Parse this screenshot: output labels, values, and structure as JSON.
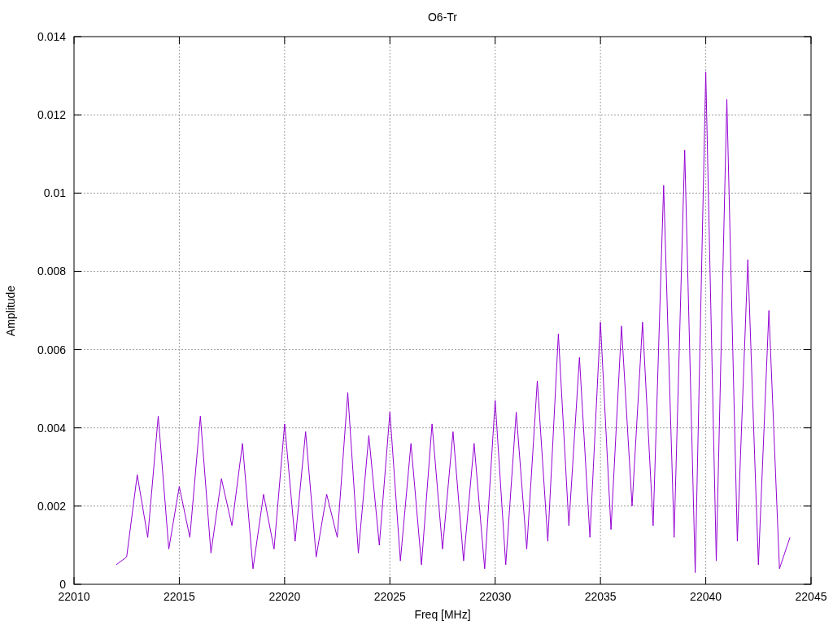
{
  "plot": {
    "chart_data": {
      "type": "line",
      "title": "O6-Tr",
      "xlabel": "Freq [MHz]",
      "ylabel": "Amplitude",
      "grid": true,
      "xlim": [
        22010,
        22045
      ],
      "ylim": [
        0,
        0.014
      ],
      "xticks": [
        22010,
        22015,
        22020,
        22025,
        22030,
        22035,
        22040,
        22045
      ],
      "yticks": [
        {
          "value": 0,
          "label": "0"
        },
        {
          "value": 0.002,
          "label": "0.002"
        },
        {
          "value": 0.004,
          "label": "0.004"
        },
        {
          "value": 0.006,
          "label": "0.006"
        },
        {
          "value": 0.008,
          "label": "0.008"
        },
        {
          "value": 0.01,
          "label": "0.01"
        },
        {
          "value": 0.012,
          "label": "0.012"
        },
        {
          "value": 0.014,
          "label": "0.014"
        }
      ],
      "x": [
        22012,
        22012.5,
        22013,
        22013.5,
        22014,
        22014.5,
        22015,
        22015.5,
        22016,
        22016.5,
        22017,
        22017.5,
        22018,
        22018.5,
        22019,
        22019.5,
        22020,
        22020.5,
        22021,
        22021.5,
        22022,
        22022.5,
        22023,
        22023.5,
        22024,
        22024.5,
        22025,
        22025.5,
        22026,
        22026.5,
        22027,
        22027.5,
        22028,
        22028.5,
        22029,
        22029.5,
        22030,
        22030.5,
        22031,
        22031.5,
        22032,
        22032.5,
        22033,
        22033.5,
        22034,
        22034.5,
        22035,
        22035.5,
        22036,
        22036.5,
        22037,
        22037.5,
        22038,
        22038.5,
        22039,
        22039.5,
        22040,
        22040.5,
        22041,
        22041.5,
        22042,
        22042.5,
        22043,
        22043.5,
        22044
      ],
      "series": [
        {
          "color": "#9400d3",
          "values": [
            0.0005,
            0.0007,
            0.0028,
            0.0012,
            0.0043,
            0.0009,
            0.0025,
            0.0012,
            0.0043,
            0.0008,
            0.0027,
            0.0015,
            0.0036,
            0.0004,
            0.0023,
            0.0009,
            0.0041,
            0.0011,
            0.0039,
            0.0007,
            0.0023,
            0.0012,
            0.0049,
            0.0008,
            0.0038,
            0.001,
            0.0044,
            0.0006,
            0.0036,
            0.0005,
            0.0041,
            0.0009,
            0.0039,
            0.0006,
            0.0036,
            0.0004,
            0.0047,
            0.0005,
            0.0044,
            0.0009,
            0.0052,
            0.0011,
            0.0064,
            0.0015,
            0.0058,
            0.0012,
            0.0067,
            0.0014,
            0.0066,
            0.002,
            0.0067,
            0.0015,
            0.0102,
            0.0012,
            0.0111,
            0.0003,
            0.0131,
            0.0006,
            0.0124,
            0.0011,
            0.0083,
            0.0005,
            0.007,
            0.0004,
            0.0012
          ]
        }
      ]
    }
  }
}
